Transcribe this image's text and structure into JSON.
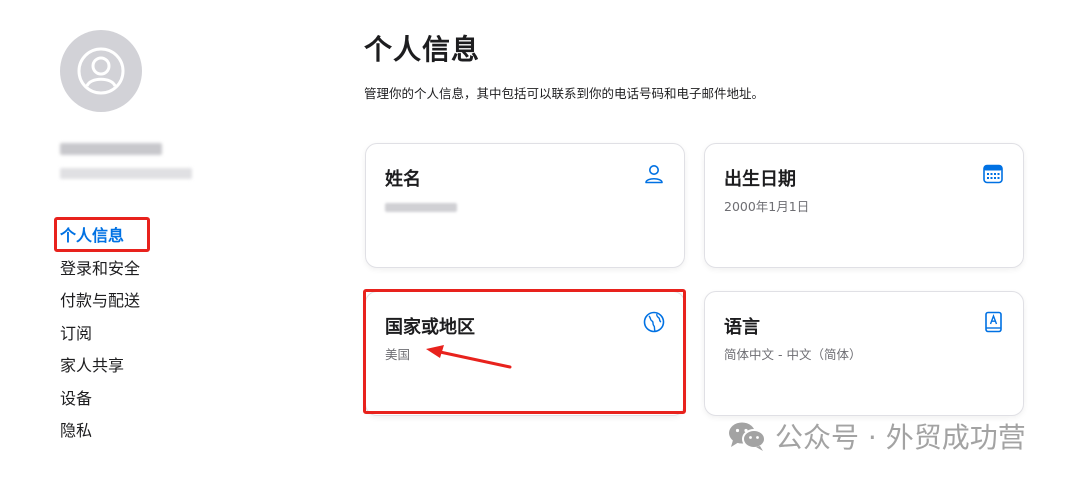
{
  "page": {
    "title": "个人信息",
    "description": "管理你的个人信息，其中包括可以联系到你的电话号码和电子邮件地址。"
  },
  "sidebar": {
    "items": [
      {
        "label": "个人信息",
        "active": true
      },
      {
        "label": "登录和安全"
      },
      {
        "label": "付款与配送"
      },
      {
        "label": "订阅"
      },
      {
        "label": "家人共享"
      },
      {
        "label": "设备"
      },
      {
        "label": "隐私"
      }
    ]
  },
  "cards": {
    "name": {
      "title": "姓名",
      "icon": "person-icon"
    },
    "birthday": {
      "title": "出生日期",
      "value": "2000年1月1日",
      "icon": "calendar-icon"
    },
    "country": {
      "title": "国家或地区",
      "value": "美国",
      "icon": "globe-icon"
    },
    "language": {
      "title": "语言",
      "value": "简体中文 - 中文（简体）",
      "icon": "book-icon"
    }
  },
  "watermark": {
    "text": "公众号 · 外贸成功营",
    "icon": "wechat-icon"
  },
  "colors": {
    "accent": "#0071e3",
    "highlight": "#e8221d",
    "watermark": "#a3a3a3"
  }
}
